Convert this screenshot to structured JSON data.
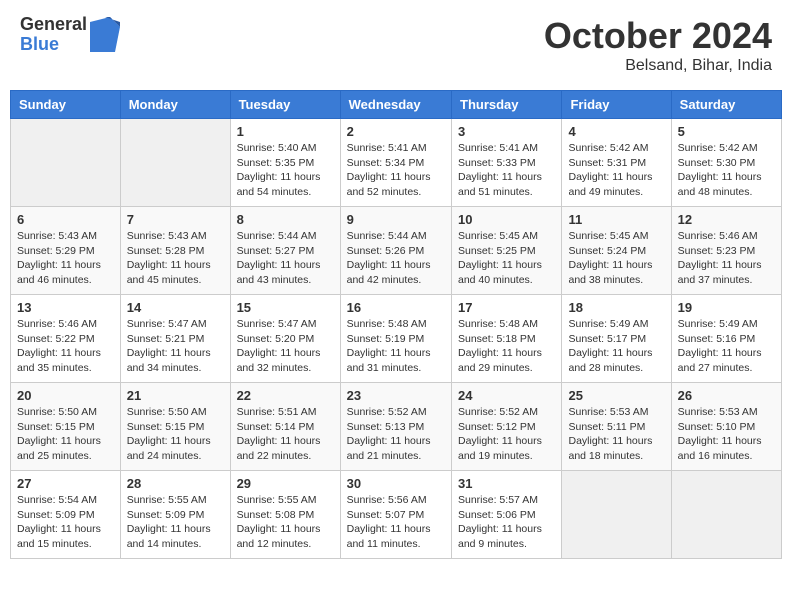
{
  "header": {
    "logo_general": "General",
    "logo_blue": "Blue",
    "month_title": "October 2024",
    "location": "Belsand, Bihar, India"
  },
  "days_of_week": [
    "Sunday",
    "Monday",
    "Tuesday",
    "Wednesday",
    "Thursday",
    "Friday",
    "Saturday"
  ],
  "weeks": [
    [
      {
        "day": "",
        "info": ""
      },
      {
        "day": "",
        "info": ""
      },
      {
        "day": "1",
        "info": "Sunrise: 5:40 AM\nSunset: 5:35 PM\nDaylight: 11 hours and 54 minutes."
      },
      {
        "day": "2",
        "info": "Sunrise: 5:41 AM\nSunset: 5:34 PM\nDaylight: 11 hours and 52 minutes."
      },
      {
        "day": "3",
        "info": "Sunrise: 5:41 AM\nSunset: 5:33 PM\nDaylight: 11 hours and 51 minutes."
      },
      {
        "day": "4",
        "info": "Sunrise: 5:42 AM\nSunset: 5:31 PM\nDaylight: 11 hours and 49 minutes."
      },
      {
        "day": "5",
        "info": "Sunrise: 5:42 AM\nSunset: 5:30 PM\nDaylight: 11 hours and 48 minutes."
      }
    ],
    [
      {
        "day": "6",
        "info": "Sunrise: 5:43 AM\nSunset: 5:29 PM\nDaylight: 11 hours and 46 minutes."
      },
      {
        "day": "7",
        "info": "Sunrise: 5:43 AM\nSunset: 5:28 PM\nDaylight: 11 hours and 45 minutes."
      },
      {
        "day": "8",
        "info": "Sunrise: 5:44 AM\nSunset: 5:27 PM\nDaylight: 11 hours and 43 minutes."
      },
      {
        "day": "9",
        "info": "Sunrise: 5:44 AM\nSunset: 5:26 PM\nDaylight: 11 hours and 42 minutes."
      },
      {
        "day": "10",
        "info": "Sunrise: 5:45 AM\nSunset: 5:25 PM\nDaylight: 11 hours and 40 minutes."
      },
      {
        "day": "11",
        "info": "Sunrise: 5:45 AM\nSunset: 5:24 PM\nDaylight: 11 hours and 38 minutes."
      },
      {
        "day": "12",
        "info": "Sunrise: 5:46 AM\nSunset: 5:23 PM\nDaylight: 11 hours and 37 minutes."
      }
    ],
    [
      {
        "day": "13",
        "info": "Sunrise: 5:46 AM\nSunset: 5:22 PM\nDaylight: 11 hours and 35 minutes."
      },
      {
        "day": "14",
        "info": "Sunrise: 5:47 AM\nSunset: 5:21 PM\nDaylight: 11 hours and 34 minutes."
      },
      {
        "day": "15",
        "info": "Sunrise: 5:47 AM\nSunset: 5:20 PM\nDaylight: 11 hours and 32 minutes."
      },
      {
        "day": "16",
        "info": "Sunrise: 5:48 AM\nSunset: 5:19 PM\nDaylight: 11 hours and 31 minutes."
      },
      {
        "day": "17",
        "info": "Sunrise: 5:48 AM\nSunset: 5:18 PM\nDaylight: 11 hours and 29 minutes."
      },
      {
        "day": "18",
        "info": "Sunrise: 5:49 AM\nSunset: 5:17 PM\nDaylight: 11 hours and 28 minutes."
      },
      {
        "day": "19",
        "info": "Sunrise: 5:49 AM\nSunset: 5:16 PM\nDaylight: 11 hours and 27 minutes."
      }
    ],
    [
      {
        "day": "20",
        "info": "Sunrise: 5:50 AM\nSunset: 5:15 PM\nDaylight: 11 hours and 25 minutes."
      },
      {
        "day": "21",
        "info": "Sunrise: 5:50 AM\nSunset: 5:15 PM\nDaylight: 11 hours and 24 minutes."
      },
      {
        "day": "22",
        "info": "Sunrise: 5:51 AM\nSunset: 5:14 PM\nDaylight: 11 hours and 22 minutes."
      },
      {
        "day": "23",
        "info": "Sunrise: 5:52 AM\nSunset: 5:13 PM\nDaylight: 11 hours and 21 minutes."
      },
      {
        "day": "24",
        "info": "Sunrise: 5:52 AM\nSunset: 5:12 PM\nDaylight: 11 hours and 19 minutes."
      },
      {
        "day": "25",
        "info": "Sunrise: 5:53 AM\nSunset: 5:11 PM\nDaylight: 11 hours and 18 minutes."
      },
      {
        "day": "26",
        "info": "Sunrise: 5:53 AM\nSunset: 5:10 PM\nDaylight: 11 hours and 16 minutes."
      }
    ],
    [
      {
        "day": "27",
        "info": "Sunrise: 5:54 AM\nSunset: 5:09 PM\nDaylight: 11 hours and 15 minutes."
      },
      {
        "day": "28",
        "info": "Sunrise: 5:55 AM\nSunset: 5:09 PM\nDaylight: 11 hours and 14 minutes."
      },
      {
        "day": "29",
        "info": "Sunrise: 5:55 AM\nSunset: 5:08 PM\nDaylight: 11 hours and 12 minutes."
      },
      {
        "day": "30",
        "info": "Sunrise: 5:56 AM\nSunset: 5:07 PM\nDaylight: 11 hours and 11 minutes."
      },
      {
        "day": "31",
        "info": "Sunrise: 5:57 AM\nSunset: 5:06 PM\nDaylight: 11 hours and 9 minutes."
      },
      {
        "day": "",
        "info": ""
      },
      {
        "day": "",
        "info": ""
      }
    ]
  ]
}
